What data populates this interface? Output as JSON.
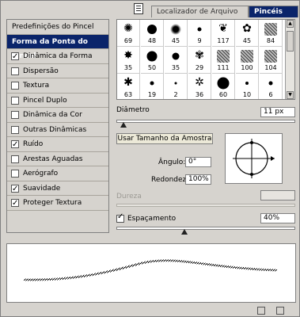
{
  "tabs": {
    "file_browser": "Localizador de Arquivo",
    "brushes": "Pincéis"
  },
  "left_list": {
    "presets": "Predefinições do Pincel",
    "tip_shape": "Forma da Ponta do Pincel",
    "items": [
      {
        "label": "Dinâmica da Forma",
        "checked": true
      },
      {
        "label": "Dispersão",
        "checked": false
      },
      {
        "label": "Textura",
        "checked": false
      },
      {
        "label": "Pincel Duplo",
        "checked": false
      },
      {
        "label": "Dinâmica da Cor",
        "checked": false
      },
      {
        "label": "Outras Dinâmicas",
        "checked": false
      },
      {
        "label": "Ruído",
        "checked": true
      },
      {
        "label": "Arestas Aguadas",
        "checked": false
      },
      {
        "label": "Aerógrafo",
        "checked": false
      },
      {
        "label": "Suavidade",
        "checked": true
      },
      {
        "label": "Proteger Textura",
        "checked": true
      }
    ]
  },
  "brush_grid": {
    "rows": [
      [
        "69",
        "48",
        "45",
        "9",
        "117",
        "45",
        "84"
      ],
      [
        "35",
        "50",
        "35",
        "29",
        "111",
        "100",
        "104"
      ],
      [
        "63",
        "19",
        "2",
        "36",
        "60",
        "10",
        "6"
      ]
    ],
    "icons": [
      [
        "burst-brush-icon",
        "hard-round-brush-icon",
        "soft-round-brush-icon",
        "small-round-brush-icon",
        "leaf-brush-icon",
        "duck-brush-icon",
        "texture-brush-icon"
      ],
      [
        "star-brush-icon",
        "hard-round-brush-icon",
        "hard-round-brush-icon",
        "butterfly-brush-icon",
        "texture-brush-icon",
        "texture-brush-icon",
        "texture-brush-icon"
      ],
      [
        "splatter-brush-icon",
        "hard-round-brush-icon",
        "tiny-round-brush-icon",
        "grass-brush-icon",
        "hard-round-brush-icon",
        "hard-round-brush-icon",
        "small-round-brush-icon"
      ]
    ],
    "partial_row": [
      "·",
      "·",
      "·",
      "·",
      "●",
      "·",
      "·"
    ]
  },
  "controls": {
    "diameter_label": "Diâmetro",
    "diameter_value": "11 px",
    "use_sample_label": "Usar Tamanho da Amostra",
    "angle_label": "Ângulo:",
    "angle_value": "0°",
    "roundness_label": "Redondez:",
    "roundness_value": "100%",
    "hardness_label": "Dureza",
    "spacing_label": "Espaçamento",
    "spacing_value": "40%",
    "spacing_checked": true
  }
}
